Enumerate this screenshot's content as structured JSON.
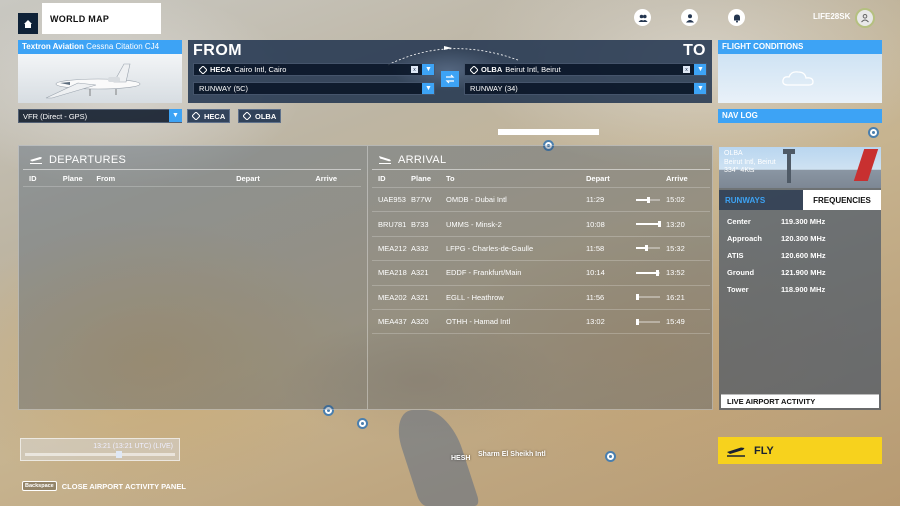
{
  "topbar": {
    "tab_label": "WORLD MAP",
    "username": "LIFE28SK"
  },
  "aircraft": {
    "maker": "Textron Aviation",
    "model": "Cessna Citation CJ4"
  },
  "route": {
    "from_label": "FROM",
    "to_label": "TO",
    "from_airport": {
      "icao": "HECA",
      "name": "Cairo Intl, Cairo"
    },
    "to_airport": {
      "icao": "OLBA",
      "name": "Beirut Intl, Beirut"
    },
    "from_runway": "RUNWAY (5C)",
    "to_runway": "RUNWAY (34)"
  },
  "conditions": {
    "title": "FLIGHT CONDITIONS"
  },
  "flight_type": "VFR (Direct - GPS)",
  "waypoints": [
    "HECA",
    "OLBA"
  ],
  "navlog": {
    "title": "NAV LOG"
  },
  "departures": {
    "title": "DEPARTURES",
    "headers": {
      "id": "ID",
      "plane": "Plane",
      "from": "From",
      "depart": "Depart",
      "arrive": "Arrive"
    }
  },
  "arrival": {
    "title": "ARRIVAL",
    "headers": {
      "id": "ID",
      "plane": "Plane",
      "to": "To",
      "depart": "Depart",
      "arrive": "Arrive"
    },
    "rows": [
      {
        "id": "UAE953",
        "plane": "B77W",
        "to": "OMDB - Dubai Intl",
        "depart": "11:29",
        "arrive": "15:02",
        "progress": 0.55
      },
      {
        "id": "BRU781",
        "plane": "B733",
        "to": "UMMS - Minsk-2",
        "depart": "10:08",
        "arrive": "13:20",
        "progress": 1.0
      },
      {
        "id": "MEA212",
        "plane": "A332",
        "to": "LFPG - Charles-de-Gaulle",
        "depart": "11:58",
        "arrive": "15:32",
        "progress": 0.45
      },
      {
        "id": "MEA218",
        "plane": "A321",
        "to": "EDDF - Frankfurt/Main",
        "depart": "10:14",
        "arrive": "13:52",
        "progress": 0.9
      },
      {
        "id": "MEA202",
        "plane": "A321",
        "to": "EGLL - Heathrow",
        "depart": "11:56",
        "arrive": "16:21",
        "progress": 0.1
      },
      {
        "id": "MEA437",
        "plane": "A320",
        "to": "OTHH - Hamad Intl",
        "depart": "13:02",
        "arrive": "15:49",
        "progress": 0.05
      }
    ]
  },
  "airport_info": {
    "icao": "OLBA",
    "name": "Beirut Intl, Beirut",
    "wind": "334° 4Kts",
    "tab_runways": "RUNWAYS",
    "tab_frequencies": "FREQUENCIES",
    "frequencies": [
      {
        "name": "Center",
        "value": "119.300 MHz"
      },
      {
        "name": "Approach",
        "value": "120.300 MHz"
      },
      {
        "name": "ATIS",
        "value": "120.600 MHz"
      },
      {
        "name": "Ground",
        "value": "121.900 MHz"
      },
      {
        "name": "Tower",
        "value": "118.900 MHz"
      }
    ],
    "live_activity": "LIVE AIRPORT ACTIVITY"
  },
  "time": {
    "text": "13:21 (13:21 UTC) (LIVE)",
    "position": 0.62
  },
  "fly_label": "FLY",
  "bottom": {
    "key": "Backspace",
    "label": "CLOSE AIRPORT ACTIVITY PANEL"
  },
  "map_labels": {
    "hesh": "HESH",
    "sharm": "Sharm El Sheikh Intl"
  },
  "colors": {
    "accent": "#3da3f5",
    "fly": "#f7d21d",
    "panel": "#182d4b"
  }
}
